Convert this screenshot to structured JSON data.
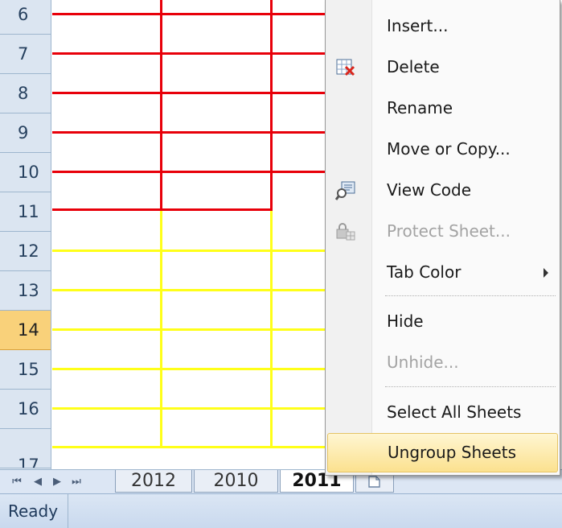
{
  "rows": [
    "6",
    "7",
    "8",
    "9",
    "10",
    "11",
    "12",
    "13",
    "14",
    "15",
    "16",
    "17"
  ],
  "selected_row": "14",
  "colors": {
    "red_border": "#e8000a",
    "yellow_border": "#ffff19",
    "menu_hover": "#fbe18f"
  },
  "tabs": {
    "nav_first": "⏮",
    "nav_prev": "◀",
    "nav_next": "▶",
    "nav_last": "⏭",
    "sheets": [
      "2012",
      "2010",
      "2011"
    ],
    "active": "2011",
    "new_sheet_icon": "new-sheet-icon"
  },
  "status": {
    "ready": "Ready"
  },
  "context_menu": {
    "items": [
      {
        "label": "Insert...",
        "accel": "I",
        "icon": "",
        "disabled": false
      },
      {
        "label": "Delete",
        "accel": "D",
        "icon": "delete-sheet-icon",
        "disabled": false
      },
      {
        "label": "Rename",
        "accel": "R",
        "icon": "",
        "disabled": false
      },
      {
        "label": "Move or Copy...",
        "accel": "M",
        "icon": "",
        "disabled": false
      },
      {
        "label": "View Code",
        "accel": "V",
        "icon": "view-code-icon",
        "disabled": false
      },
      {
        "label": "Protect Sheet...",
        "accel": "P",
        "icon": "protect-sheet-icon",
        "disabled": true
      },
      {
        "label": "Tab Color",
        "accel": "T",
        "icon": "",
        "disabled": false,
        "submenu": true
      },
      {
        "label": "Hide",
        "accel": "H",
        "icon": "",
        "disabled": false
      },
      {
        "label": "Unhide...",
        "accel": "U",
        "icon": "",
        "disabled": true
      },
      {
        "label": "Select All Sheets",
        "accel": "S",
        "icon": "",
        "disabled": false
      },
      {
        "label": "Ungroup Sheets",
        "accel": "U",
        "icon": "",
        "disabled": false,
        "hover": true
      }
    ]
  }
}
